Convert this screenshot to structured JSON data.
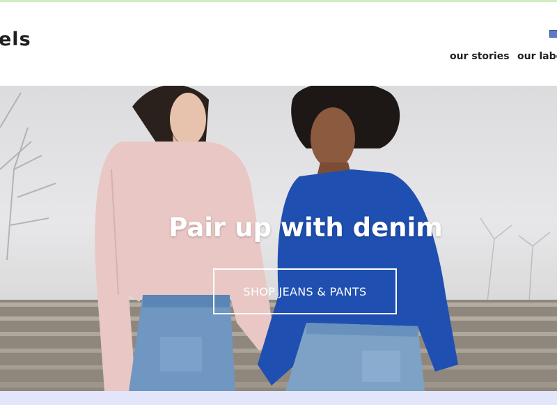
{
  "header": {
    "logo_text": "els",
    "nav": [
      {
        "label": "our stories"
      },
      {
        "label": "our labe"
      }
    ]
  },
  "hero": {
    "headline": "Pair up with denim",
    "cta_label": "SHOP JEANS & PANTS"
  },
  "colors": {
    "topbar": "#cfeec2",
    "bottom_strip": "#e3e6fb",
    "sweater_pink": "#e8c5c3",
    "sweater_blue": "#1f4fb0",
    "denim": "#7ea1c6"
  }
}
